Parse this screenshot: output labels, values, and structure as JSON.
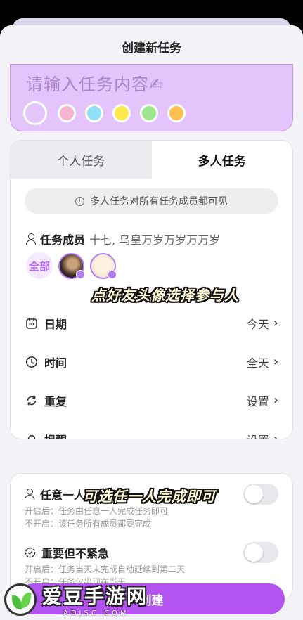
{
  "sheet": {
    "title": "创建新任务"
  },
  "note": {
    "placeholder": "请输入任务内容✍",
    "color_dots": [
      "#ffffff",
      "#f8b3d3",
      "#8fe0f5",
      "#ffe84a",
      "#9ee68e",
      "#ffc04d"
    ],
    "bg_color": "#e3c4fb"
  },
  "tabs": [
    {
      "label": "个人任务",
      "active": false
    },
    {
      "label": "多人任务",
      "active": true
    }
  ],
  "notice": {
    "text": "多人任务对所有任务成员都可见",
    "icon": "info-icon"
  },
  "members": {
    "title": "任务成员",
    "names": "十七, 乌皇万岁万岁万万岁",
    "all_label": "全部"
  },
  "rows": [
    {
      "icon": "calendar-icon",
      "label": "日期",
      "value": "今天"
    },
    {
      "icon": "clock-icon",
      "label": "时间",
      "value": "全天"
    },
    {
      "icon": "repeat-icon",
      "label": "重复",
      "value": "设置"
    },
    {
      "icon": "bell-icon",
      "label": "提醒",
      "value": "设置"
    }
  ],
  "options": [
    {
      "icon": "person-icon",
      "title": "任意一人完成即可",
      "on_desc": "开启后：任务由任意一人完成任务即可",
      "off_desc": "不开启：该任务所有成员都要完成",
      "enabled": false
    },
    {
      "icon": "smile-clock-icon",
      "title": "重要但不紧急",
      "on_desc": "开启后：任务当天未完成自动延续到第二天",
      "off_desc": "不开启：任务仅出现在当天",
      "enabled": false
    }
  ],
  "create_button": {
    "label": "创建"
  },
  "captions": {
    "avatar_tip": "点好友头像选择参与人",
    "option_tip": "可选任一人完成即可"
  },
  "watermark": {
    "main": "爱豆手游网",
    "sub": "ADJSC.COM"
  },
  "colors": {
    "accent": "#b353f0",
    "note_border": "#c995f2"
  }
}
